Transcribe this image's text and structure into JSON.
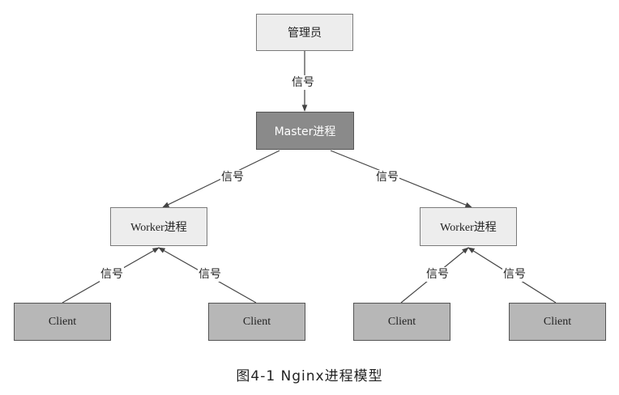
{
  "nodes": {
    "admin": "管理员",
    "master": "Master进程",
    "worker_left": "Worker进程",
    "worker_right": "Worker进程",
    "client_1": "Client",
    "client_2": "Client",
    "client_3": "Client",
    "client_4": "Client"
  },
  "edge_label": "信号",
  "caption": "图4-1   Nginx进程模型",
  "colors": {
    "light_box": "#ededed",
    "master_box": "#8a8a8a",
    "client_box": "#b7b7b7",
    "line": "#444444"
  }
}
